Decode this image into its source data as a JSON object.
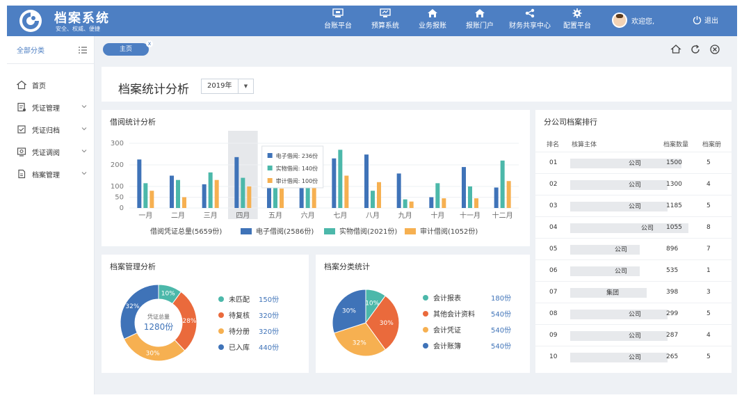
{
  "header": {
    "title": "档案系统",
    "subtitle": "安全、权威、便捷",
    "nav": [
      {
        "label": "台账平台",
        "icon": "monitor-icon"
      },
      {
        "label": "预算系统",
        "icon": "budget-icon"
      },
      {
        "label": "业务报账",
        "icon": "home-icon"
      },
      {
        "label": "报账门户",
        "icon": "home-icon"
      },
      {
        "label": "财务共享中心",
        "icon": "share-icon"
      },
      {
        "label": "配置平台",
        "icon": "gear-icon"
      }
    ],
    "welcome": "欢迎您,",
    "logout": "退出"
  },
  "sidebar": {
    "heading": "全部分类",
    "items": [
      {
        "label": "首页",
        "icon": "home-icon"
      },
      {
        "label": "凭证管理",
        "icon": "voucher-icon"
      },
      {
        "label": "凭证归档",
        "icon": "archive-icon"
      },
      {
        "label": "凭证调阅",
        "icon": "review-icon"
      },
      {
        "label": "档案管理",
        "icon": "file-icon"
      }
    ]
  },
  "tabs": {
    "active": "主页",
    "close": "x"
  },
  "page": {
    "title": "档案统计分析",
    "year": "2019年"
  },
  "borrow": {
    "title": "借阅统计分析",
    "tooltip": [
      "电子借阅: 236份",
      "实物借阅: 140份",
      "审计借阅: 100份"
    ],
    "legend_total": "借阅凭证总量(5659份)",
    "legend": [
      "电子借阅(2586份)",
      "实物借阅(2021份)",
      "审计借阅(1052份)"
    ]
  },
  "colors": {
    "blue": "#3f73b8",
    "teal": "#4cb8aa",
    "orange": "#f6b051",
    "red": "#ea6a3c",
    "header": "#4d7fc3"
  },
  "chart_data": [
    {
      "type": "bar",
      "title": "借阅统计分析",
      "categories": [
        "一月",
        "二月",
        "三月",
        "四月",
        "五月",
        "六月",
        "七月",
        "八月",
        "九月",
        "十月",
        "十一月",
        "十二月"
      ],
      "series": [
        {
          "name": "电子借阅",
          "values": [
            225,
            150,
            110,
            236,
            215,
            230,
            230,
            248,
            160,
            50,
            190,
            95
          ]
        },
        {
          "name": "实物借阅",
          "values": [
            115,
            130,
            165,
            140,
            110,
            120,
            270,
            80,
            40,
            115,
            100,
            220
          ]
        },
        {
          "name": "审计借阅",
          "values": [
            80,
            50,
            130,
            100,
            90,
            110,
            150,
            120,
            30,
            45,
            45,
            125
          ]
        }
      ],
      "yticks": [
        0,
        50,
        100,
        200,
        300
      ],
      "ylim": [
        0,
        300
      ],
      "highlight": "四月"
    },
    {
      "type": "pie",
      "title": "档案管理分析",
      "center_label": "凭证总量",
      "center_value": "1280份",
      "slices": [
        {
          "name": "未匹配",
          "value": 10,
          "label": "10%",
          "display": "150份"
        },
        {
          "name": "待复核",
          "value": 28,
          "label": "28%",
          "display": "320份"
        },
        {
          "name": "待分册",
          "value": 30,
          "label": "30%",
          "display": "320份"
        },
        {
          "name": "已入库",
          "value": 32,
          "label": "32%",
          "display": "440份"
        }
      ]
    },
    {
      "type": "pie",
      "title": "档案分类统计",
      "slices": [
        {
          "name": "会计报表",
          "value": 10,
          "label": "10%",
          "display": "180份"
        },
        {
          "name": "其他会计资料",
          "value": 30,
          "label": "30%",
          "display": "540份"
        },
        {
          "name": "会计凭证",
          "value": 30,
          "label": "32%",
          "display": "540份"
        },
        {
          "name": "会计账簿",
          "value": 30,
          "label": "30%",
          "display": "540份"
        }
      ]
    }
  ],
  "ranking": {
    "title": "分公司档案排行",
    "headers": [
      "排名",
      "核算主体",
      "档案数量",
      "档案册"
    ],
    "rows": [
      {
        "rank": "01",
        "name": "公司",
        "count": "1500",
        "volumes": "5"
      },
      {
        "rank": "02",
        "name": "公司",
        "count": "1300",
        "volumes": "4"
      },
      {
        "rank": "03",
        "name": "公司",
        "count": "1185",
        "volumes": "5"
      },
      {
        "rank": "04",
        "name": "公司",
        "count": "1055",
        "volumes": "8"
      },
      {
        "rank": "05",
        "name": "公司",
        "count": "896",
        "volumes": "7"
      },
      {
        "rank": "06",
        "name": "公司",
        "count": "535",
        "volumes": "1"
      },
      {
        "rank": "07",
        "name": "集团",
        "count": "398",
        "volumes": "3"
      },
      {
        "rank": "08",
        "name": "公司",
        "count": "299",
        "volumes": "5"
      },
      {
        "rank": "09",
        "name": "公司",
        "count": "287",
        "volumes": "4"
      },
      {
        "rank": "10",
        "name": "公司",
        "count": "265",
        "volumes": "5"
      }
    ]
  }
}
